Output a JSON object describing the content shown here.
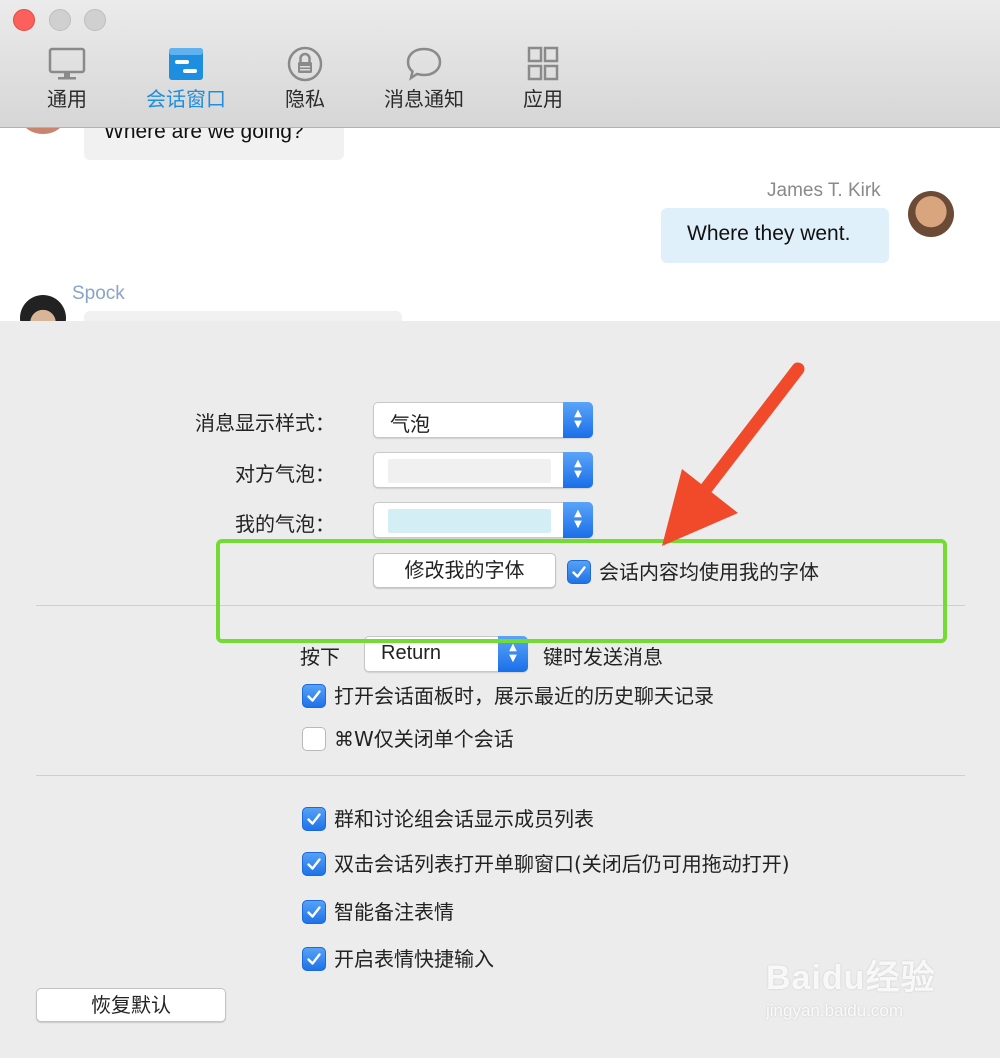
{
  "toolbar": {
    "tabs": [
      {
        "label": "通用",
        "icon": "monitor-icon"
      },
      {
        "label": "会话窗口",
        "icon": "chat-window-icon"
      },
      {
        "label": "隐私",
        "icon": "lock-icon"
      },
      {
        "label": "消息通知",
        "icon": "speech-bubble-icon"
      },
      {
        "label": "应用",
        "icon": "grid-icon"
      }
    ],
    "active_tab": "会话窗口",
    "accent_color": "#1e8fe0"
  },
  "chat_preview": {
    "top_message": "Where are we going?",
    "kirk_name": "James T. Kirk",
    "kirk_message": "Where they went.",
    "spock_name": "Spock"
  },
  "settings": {
    "bubble_style_label": "消息显示样式：",
    "bubble_style_value": "气泡",
    "other_bubble_label": "对方气泡：",
    "other_bubble_color": "#f0f0f0",
    "my_bubble_label": "我的气泡：",
    "my_bubble_color": "#d4eef6",
    "change_font_button": "修改我的字体",
    "use_my_font_checkbox": {
      "label": "会话内容均使用我的字体",
      "checked": true
    },
    "send_key_prefix": "按下",
    "send_key_value": "Return",
    "send_key_suffix": "键时发送消息",
    "show_history_checkbox": {
      "label": "打开会话面板时，展示最近的历史聊天记录",
      "checked": true
    },
    "cmd_w_checkbox": {
      "label": "⌘W仅关闭单个会话",
      "checked": false
    },
    "group_members_checkbox": {
      "label": "群和讨论组会话显示成员列表",
      "checked": true
    },
    "double_click_checkbox": {
      "label": "双击会话列表打开单聊窗口(关闭后仍可用拖动打开)",
      "checked": true
    },
    "smart_emoji_checkbox": {
      "label": "智能备注表情",
      "checked": true
    },
    "emoji_shortcut_checkbox": {
      "label": "开启表情快捷输入",
      "checked": true
    },
    "restore_defaults_button": "恢复默认"
  },
  "annotations": {
    "highlight_color": "#72dc35",
    "arrow_color": "#f04a2a"
  },
  "watermark": {
    "logo_text": "Baidu经验",
    "url": "jingyan.baidu.com"
  }
}
